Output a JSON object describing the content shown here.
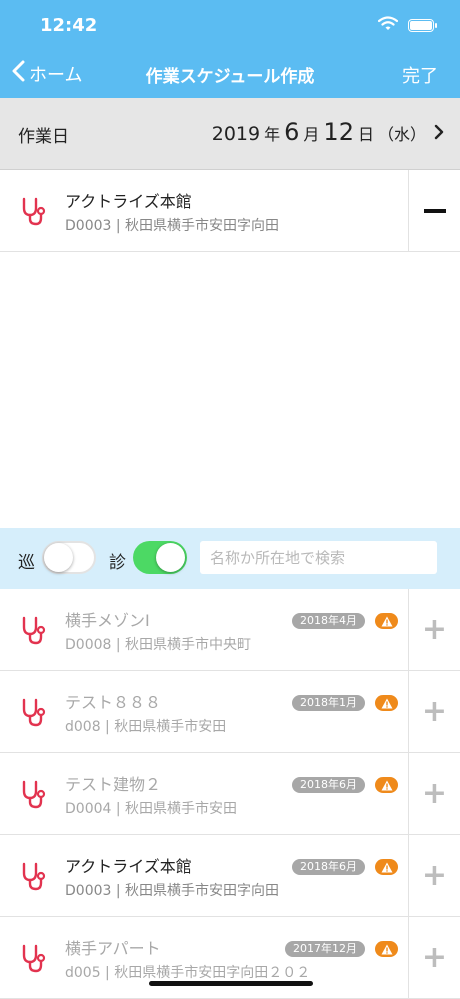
{
  "status": {
    "time": "12:42"
  },
  "nav": {
    "back_label": "ホーム",
    "title": "作業スケジュール作成",
    "done_label": "完了"
  },
  "date": {
    "label": "作業日",
    "year": "2019",
    "year_unit": "年",
    "month": "6",
    "month_unit": "月",
    "day": "12",
    "day_unit": "日",
    "weekday": "（水）"
  },
  "colors": {
    "header": "#5bbcf2",
    "icon": "#e2334f",
    "toggle_on": "#4cd964",
    "warn": "#ef8a1b",
    "badge": "#a7a7a7"
  },
  "selected": [
    {
      "name": "アクトライズ本館",
      "address": "D0003 | 秋田県横手市安田字向田",
      "icon": "stethoscope-icon",
      "action": "minus-icon"
    }
  ],
  "filter": {
    "toggle1_label": "巡",
    "toggle1_on": false,
    "toggle2_label": "診",
    "toggle2_on": true,
    "search_placeholder": "名称か所在地で検索"
  },
  "buildings": [
    {
      "name": "横手メゾンⅠ",
      "address": "D0008 | 秋田県横手市中央町",
      "badge": "2018年4月",
      "dimmed": true
    },
    {
      "name": "テスト８８８",
      "address": "d008 | 秋田県横手市安田",
      "badge": "2018年1月",
      "dimmed": true
    },
    {
      "name": "テスト建物２",
      "address": "D0004 | 秋田県横手市安田",
      "badge": "2018年6月",
      "dimmed": true
    },
    {
      "name": "アクトライズ本館",
      "address": "D0003 | 秋田県横手市安田字向田",
      "badge": "2018年6月",
      "dimmed": false
    },
    {
      "name": "横手アパート",
      "address": "d005 | 秋田県横手市安田字向田２０２",
      "badge": "2017年12月",
      "dimmed": true
    }
  ]
}
